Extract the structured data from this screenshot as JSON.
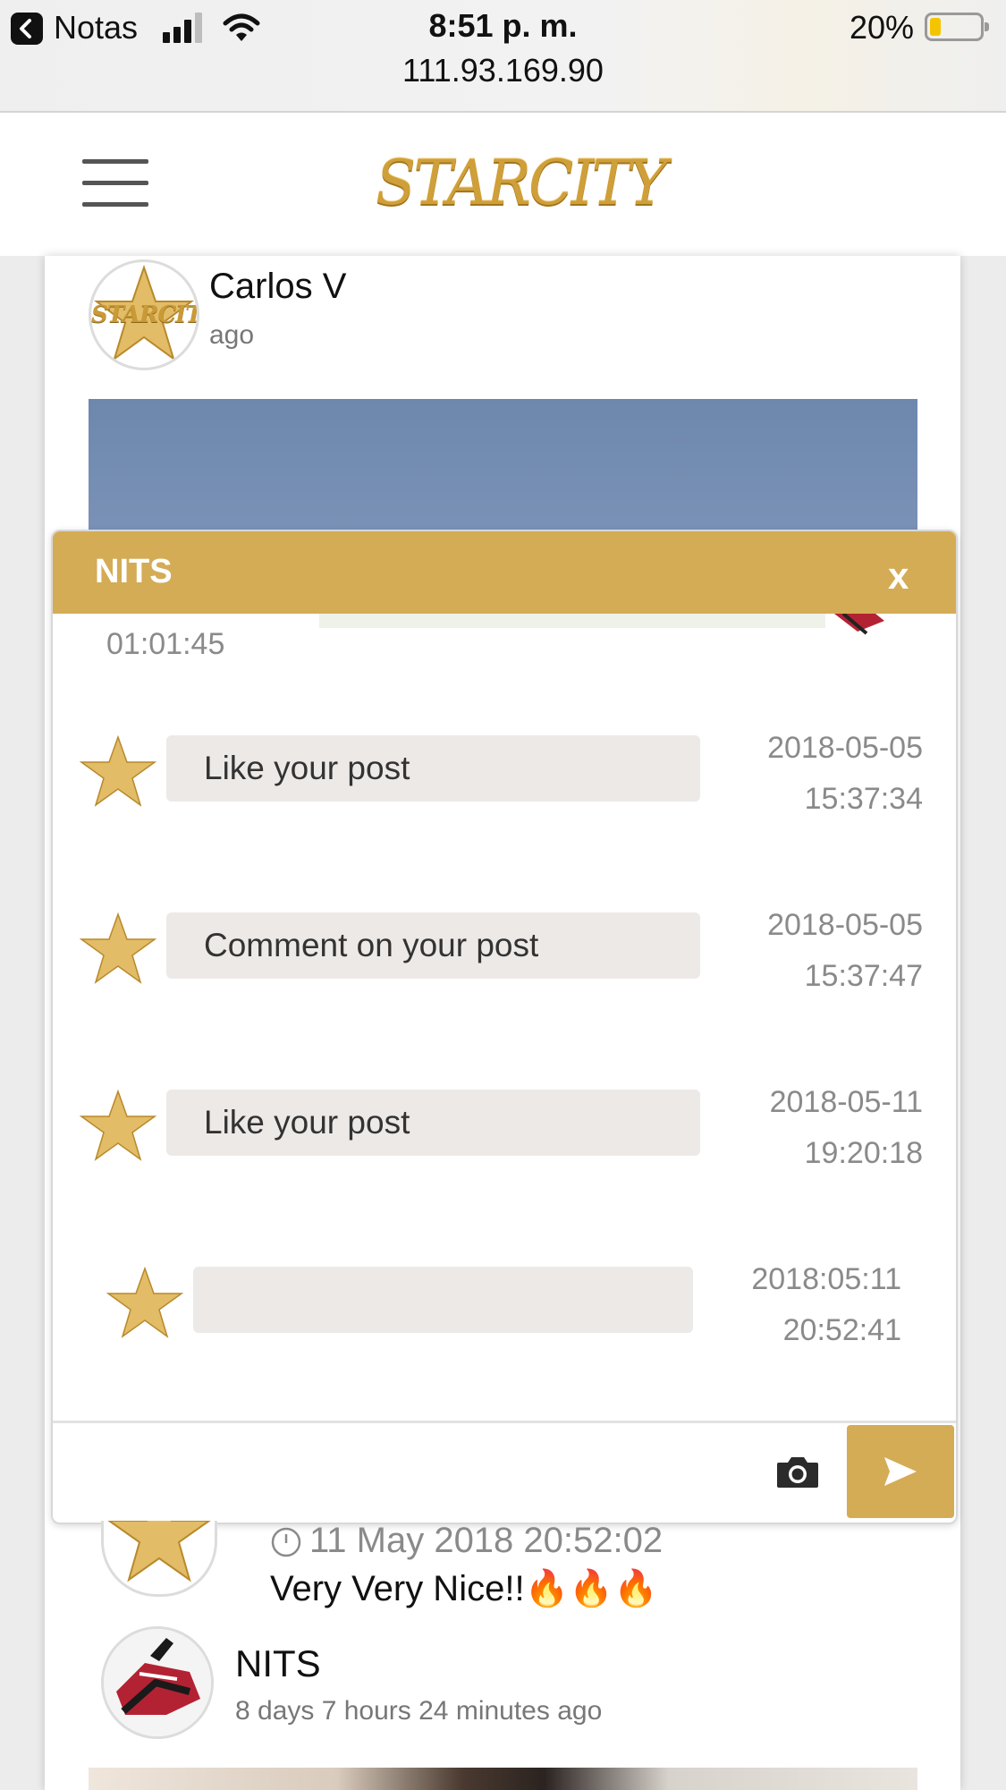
{
  "status_bar": {
    "back_label": "Notas",
    "time": "8:51 p. m.",
    "url": "111.93.169.90",
    "battery": "20%",
    "battery_level": 0.2
  },
  "header": {
    "logo_text": "STARCITY",
    "menu_icon": "hamburger-menu-icon"
  },
  "post_top": {
    "author": "Carlos V",
    "time": "ago",
    "avatar_text": "STARCITY"
  },
  "chat": {
    "title": "NITS",
    "close_label": "x",
    "partial_time": "01:01:45",
    "messages": [
      {
        "text": "Like your post",
        "date": "2018-05-05",
        "time": "15:37:34"
      },
      {
        "text": "Comment on your post",
        "date": "2018-05-05",
        "time": "15:37:47"
      },
      {
        "text": "Like your post",
        "date": "2018-05-11",
        "time": "19:20:18"
      },
      {
        "text": "",
        "date": "2018:05:11",
        "time": "20:52:41"
      }
    ],
    "input_placeholder": "",
    "camera_icon": "camera-icon",
    "send_icon": "send-icon"
  },
  "comment": {
    "timestamp": "11 May 2018 20:52:02",
    "text": "Very Very Nice!!🔥🔥🔥"
  },
  "post_bottom": {
    "author": "NITS",
    "time": "8 days 7 hours 24 minutes ago"
  },
  "colors": {
    "accent_gold": "#d4ac55",
    "bubble_bg": "#ede9e7"
  }
}
